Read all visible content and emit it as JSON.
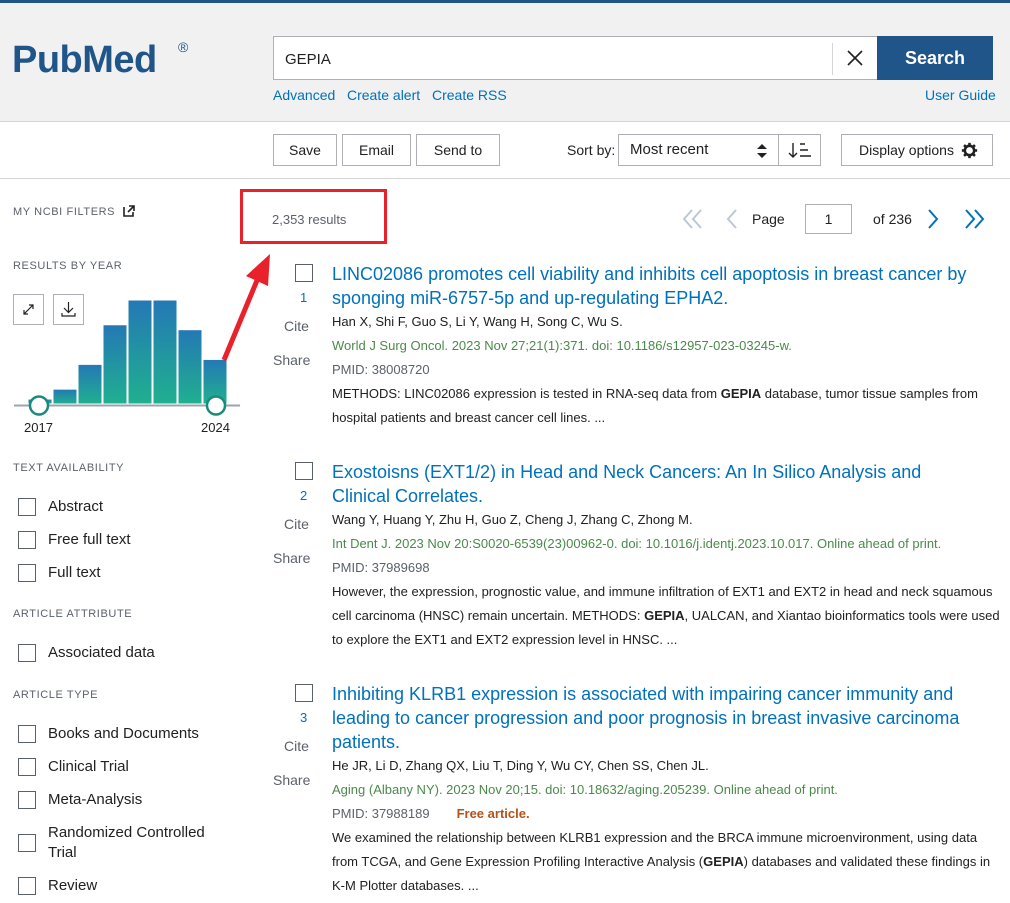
{
  "header": {
    "logo_text": "PubMed",
    "logo_reg": "®",
    "search_value": "GEPIA",
    "search_label": "Search",
    "links": [
      "Advanced",
      "Create alert",
      "Create RSS"
    ],
    "user_guide": "User Guide"
  },
  "toolbar": {
    "save": "Save",
    "email": "Email",
    "send_to": "Send to",
    "sort_label": "Sort by:",
    "sort_value": "Most recent",
    "display_options": "Display options"
  },
  "sidebar": {
    "my_ncbi_filters": "MY NCBI FILTERS",
    "results_by_year": "RESULTS BY YEAR",
    "year_start": "2017",
    "year_end": "2024",
    "text_availability": "TEXT AVAILABILITY",
    "text_options": [
      "Abstract",
      "Free full text",
      "Full text"
    ],
    "article_attribute": "ARTICLE ATTRIBUTE",
    "attribute_options": [
      "Associated data"
    ],
    "article_type": "ARTICLE TYPE",
    "type_options": [
      "Books and Documents",
      "Clinical Trial",
      "Meta-Analysis",
      "Randomized Controlled Trial",
      "Review"
    ]
  },
  "results_summary": {
    "count": "2,353 results",
    "page_label": "Page",
    "page_value": "1",
    "of_pages": "of 236"
  },
  "chart_data": {
    "type": "bar",
    "title": "",
    "x_range": [
      "2017",
      "2024"
    ],
    "values": [
      1,
      3,
      8,
      16,
      21,
      21,
      15,
      9
    ],
    "color": "#20a08f"
  },
  "results": [
    {
      "num": "1",
      "title": "LINC02086 promotes cell viability and inhibits cell apoptosis in breast cancer by sponging miR-6757-5p and up-regulating EPHA2.",
      "authors": "Han X, Shi F, Guo S, Li Y, Wang H, Song C, Wu S.",
      "journal": "World J Surg Oncol. 2023 Nov 27;21(1):371. doi: 10.1186/s12957-023-03245-w.",
      "pmid": "PMID: 38008720",
      "free": "",
      "snippet_pre": "METHODS: LINC02086 expression is tested in RNA-seq data from ",
      "snippet_bold": "GEPIA",
      "snippet_post": " database, tumor tissue samples from hospital patients and breast cancer cell lines. ..."
    },
    {
      "num": "2",
      "title": "Exostoisns (EXT1/2) in Head and Neck Cancers: An In Silico Analysis and Clinical Correlates.",
      "authors": "Wang Y, Huang Y, Zhu H, Guo Z, Cheng J, Zhang C, Zhong M.",
      "journal": "Int Dent J. 2023 Nov 20:S0020-6539(23)00962-0. doi: 10.1016/j.identj.2023.10.017. Online ahead of print.",
      "pmid": "PMID: 37989698",
      "free": "",
      "snippet_pre": "However, the expression, prognostic value, and immune infiltration of EXT1 and EXT2 in head and neck squamous cell carcinoma (HNSC) remain uncertain. METHODS: ",
      "snippet_bold": "GEPIA",
      "snippet_post": ", UALCAN, and Xiantao bioinformatics tools were used to explore the EXT1 and EXT2 expression level in HNSC. ..."
    },
    {
      "num": "3",
      "title": "Inhibiting KLRB1 expression is associated with impairing cancer immunity and leading to cancer progression and poor prognosis in breast invasive carcinoma patients.",
      "authors": "He JR, Li D, Zhang QX, Liu T, Ding Y, Wu CY, Chen SS, Chen JL.",
      "journal": "Aging (Albany NY). 2023 Nov 20;15. doi: 10.18632/aging.205239. Online ahead of print.",
      "pmid": "PMID: 37988189",
      "free": "Free article.",
      "snippet_pre": "We examined the relationship between KLRB1 expression and the BRCA immune microenvironment, using data from TCGA, and Gene Expression Profiling Interactive Analysis (",
      "snippet_bold": "GEPIA",
      "snippet_post": ") databases and validated these findings in K-M Plotter databases. ..."
    }
  ],
  "result_actions": {
    "cite": "Cite",
    "share": "Share"
  }
}
